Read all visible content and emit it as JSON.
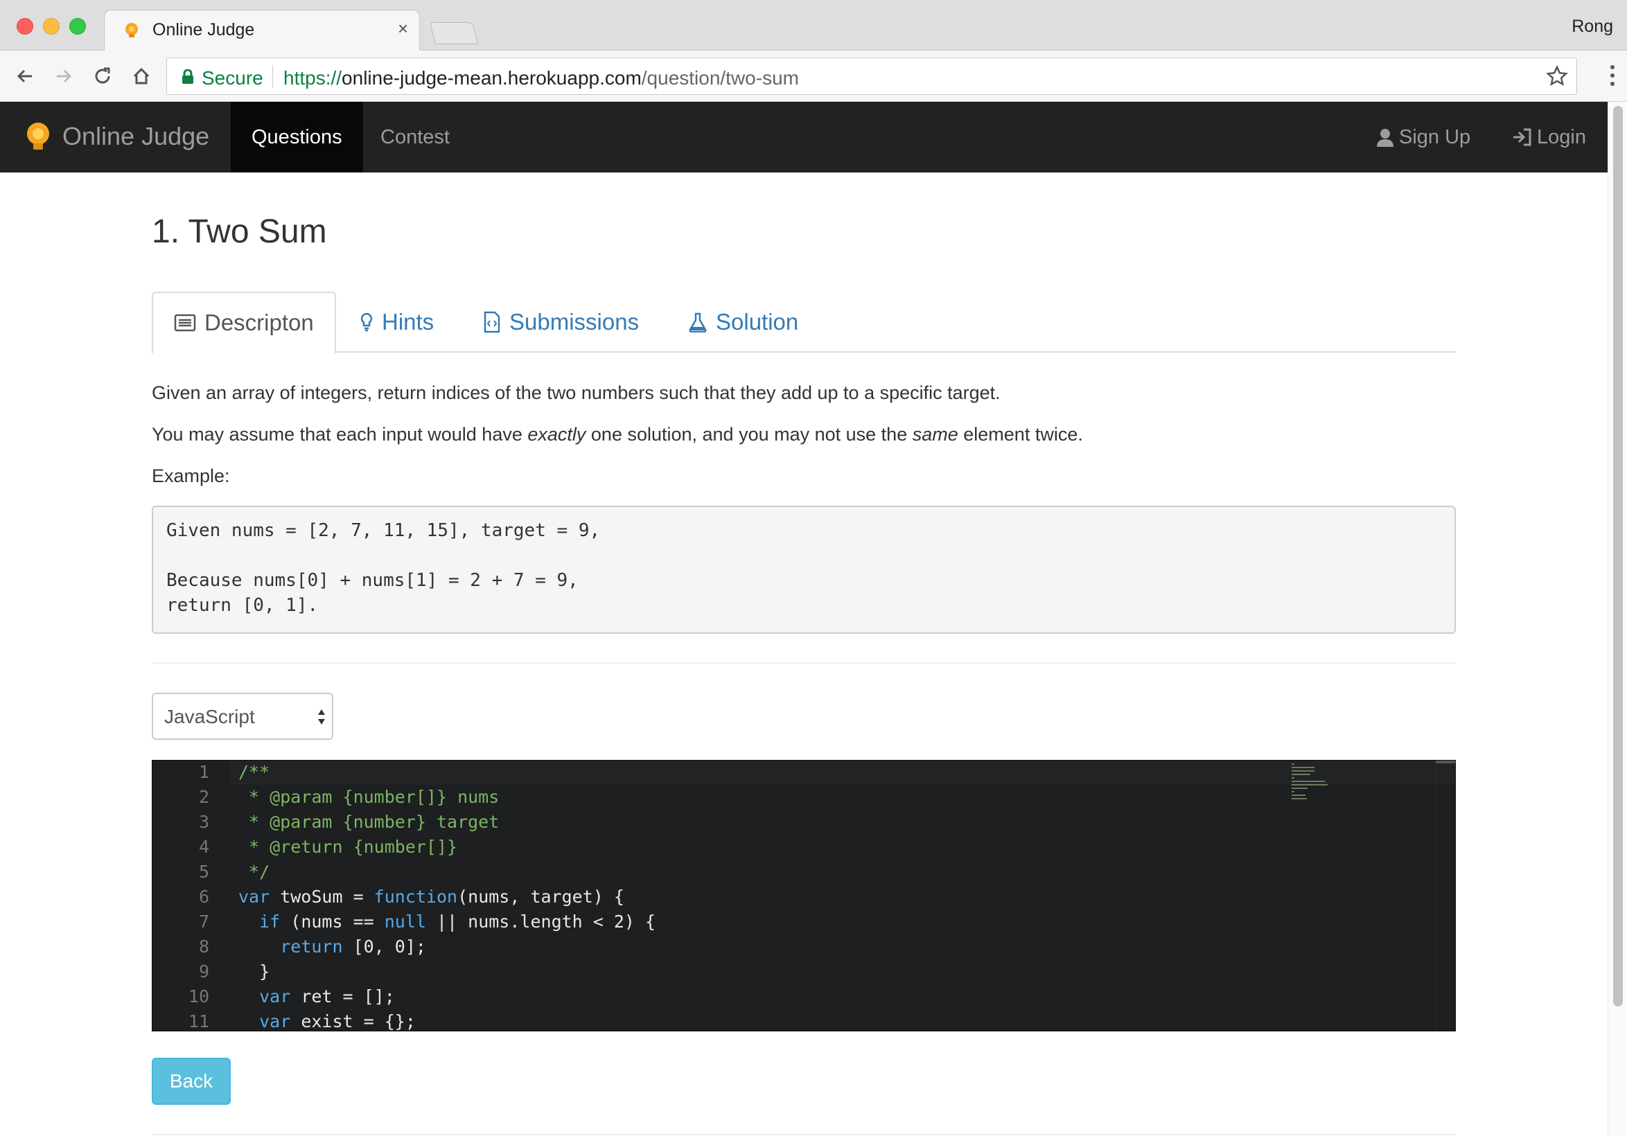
{
  "browser": {
    "tab_title": "Online Judge",
    "profile_name": "Rong",
    "secure_label": "Secure",
    "url_scheme": "https://",
    "url_host": "online-judge-mean.herokuapp.com",
    "url_path": "/question/two-sum"
  },
  "navbar": {
    "brand": "Online Judge",
    "items": [
      {
        "label": "Questions",
        "active": true
      },
      {
        "label": "Contest",
        "active": false
      }
    ],
    "signup_label": "Sign Up",
    "login_label": "Login"
  },
  "question": {
    "title": "1. Two Sum",
    "tabs": [
      {
        "label": "Descripton",
        "icon": "list-icon",
        "active": true
      },
      {
        "label": "Hints",
        "icon": "lightbulb-icon",
        "active": false
      },
      {
        "label": "Submissions",
        "icon": "code-file-icon",
        "active": false
      },
      {
        "label": "Solution",
        "icon": "flask-icon",
        "active": false
      }
    ],
    "description": {
      "line1": "Given an array of integers, return indices of the two numbers such that they add up to a specific target.",
      "line2_a": "You may assume that each input would have ",
      "line2_em1": "exactly",
      "line2_b": " one solution, and you may not use the ",
      "line2_em2": "same",
      "line2_c": " element twice.",
      "example_label": "Example:"
    },
    "example_code": [
      "Given nums = [2, 7, 11, 15], target = 9,",
      "",
      "Because nums[0] + nums[1] = 2 + 7 = 9,",
      "return [0, 1]."
    ]
  },
  "editor": {
    "language": "JavaScript",
    "line_numbers": [
      "1",
      "2",
      "3",
      "4",
      "5",
      "6",
      "7",
      "8",
      "9",
      "10",
      "11"
    ],
    "lines": [
      [
        {
          "t": "/**",
          "c": "com"
        }
      ],
      [
        {
          "t": " * @param {number[]} nums",
          "c": "com"
        }
      ],
      [
        {
          "t": " * @param {number} target",
          "c": "com"
        }
      ],
      [
        {
          "t": " * @return {number[]}",
          "c": "com"
        }
      ],
      [
        {
          "t": " */",
          "c": "com"
        }
      ],
      [
        {
          "t": "var",
          "c": "kw"
        },
        {
          "t": " twoSum = ",
          "c": ""
        },
        {
          "t": "function",
          "c": "kw"
        },
        {
          "t": "(nums, target) {",
          "c": ""
        }
      ],
      [
        {
          "t": "  ",
          "c": ""
        },
        {
          "t": "if",
          "c": "kw"
        },
        {
          "t": " (nums == ",
          "c": ""
        },
        {
          "t": "null",
          "c": "kw"
        },
        {
          "t": " || nums.length < 2) {",
          "c": ""
        }
      ],
      [
        {
          "t": "    ",
          "c": ""
        },
        {
          "t": "return",
          "c": "kw"
        },
        {
          "t": " [0, 0];",
          "c": ""
        }
      ],
      [
        {
          "t": "  }",
          "c": ""
        }
      ],
      [
        {
          "t": "  ",
          "c": ""
        },
        {
          "t": "var",
          "c": "kw"
        },
        {
          "t": " ret = [];",
          "c": ""
        }
      ],
      [
        {
          "t": "  ",
          "c": ""
        },
        {
          "t": "var",
          "c": "kw"
        },
        {
          "t": " exist = {};",
          "c": ""
        }
      ]
    ]
  },
  "actions": {
    "back_label": "Back"
  },
  "colors": {
    "navbar_bg": "#222222",
    "link": "#337ab7",
    "back_button": "#5bc0de",
    "editor_bg": "#1d1f21",
    "comment": "#7bb662",
    "keyword": "#58a9e6"
  }
}
